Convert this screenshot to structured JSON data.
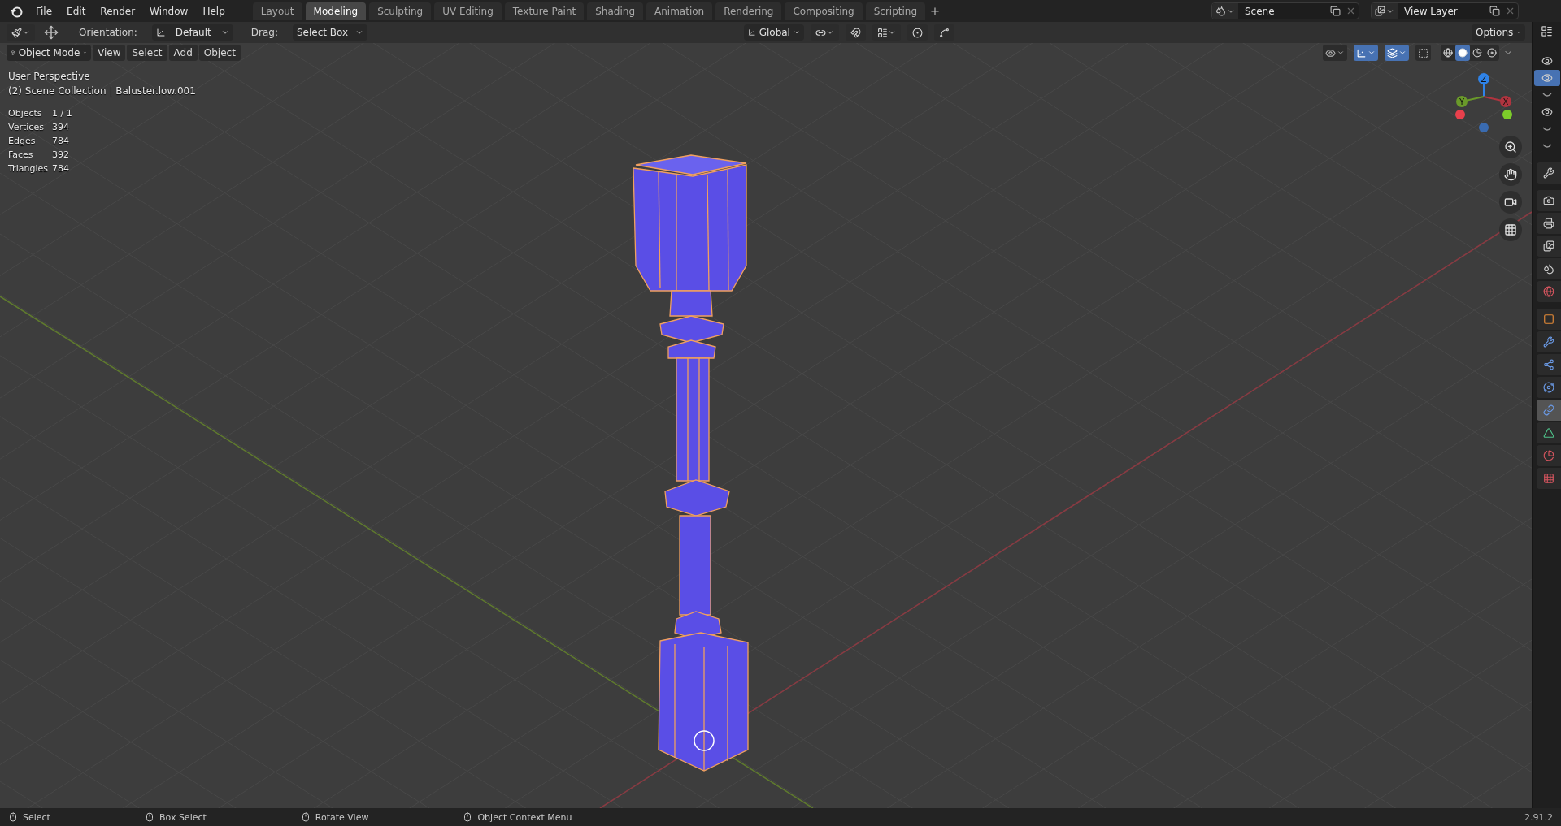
{
  "app_menu": [
    "File",
    "Edit",
    "Render",
    "Window",
    "Help"
  ],
  "workspace_tabs": [
    {
      "label": "Layout",
      "selected": false
    },
    {
      "label": "Modeling",
      "selected": true
    },
    {
      "label": "Sculpting",
      "selected": false
    },
    {
      "label": "UV Editing",
      "selected": false
    },
    {
      "label": "Texture Paint",
      "selected": false
    },
    {
      "label": "Shading",
      "selected": false
    },
    {
      "label": "Animation",
      "selected": false
    },
    {
      "label": "Rendering",
      "selected": false
    },
    {
      "label": "Compositing",
      "selected": false
    },
    {
      "label": "Scripting",
      "selected": false
    }
  ],
  "scene": {
    "value": "Scene"
  },
  "view_layer": {
    "value": "View Layer"
  },
  "tool_header": {
    "orientation_label": "Orientation:",
    "orientation": "Default",
    "drag_label": "Drag:",
    "drag": "Select Box",
    "transform_orientation": "Global",
    "options": "Options"
  },
  "viewport_header": {
    "mode": "Object Mode",
    "menus": [
      "View",
      "Select",
      "Add",
      "Object"
    ],
    "toggles": [
      {
        "kind": "selectability",
        "on": false
      },
      {
        "kind": "gizmos",
        "on": true
      },
      {
        "kind": "overlays",
        "on": true
      },
      {
        "kind": "xray",
        "on": false
      }
    ],
    "shading_modes": [
      {
        "kind": "wireframe",
        "selected": false
      },
      {
        "kind": "solid",
        "selected": true
      },
      {
        "kind": "material",
        "selected": false
      },
      {
        "kind": "rendered",
        "selected": false
      }
    ]
  },
  "overlay_info": {
    "view": "User Perspective",
    "collection": "(2) Scene Collection | Baluster.low.001",
    "stats": [
      {
        "label": "Objects",
        "value": "1 / 1"
      },
      {
        "label": "Vertices",
        "value": "394"
      },
      {
        "label": "Edges",
        "value": "784"
      },
      {
        "label": "Faces",
        "value": "392"
      },
      {
        "label": "Triangles",
        "value": "784"
      }
    ]
  },
  "gizmo_axes": [
    {
      "label": "Z",
      "color": "#2f83e8"
    },
    {
      "label": "Y",
      "color": "#6a9a2a"
    },
    {
      "label": "X",
      "color": "#b0343f"
    }
  ],
  "outliner_rows": [
    {
      "visible": true,
      "selected": false
    },
    {
      "visible": true,
      "selected": true
    },
    {
      "visible": false,
      "selected": false
    },
    {
      "visible": true,
      "selected": false
    },
    {
      "visible": false,
      "selected": false
    },
    {
      "visible": false,
      "selected": false
    }
  ],
  "properties_tabs": [
    {
      "kind": "tool",
      "selected": false
    },
    {
      "kind": "render",
      "selected": false
    },
    {
      "kind": "output",
      "selected": false
    },
    {
      "kind": "view_layer",
      "selected": false
    },
    {
      "kind": "scene",
      "selected": false
    },
    {
      "kind": "world",
      "selected": false
    },
    {
      "kind": "object",
      "selected": false
    },
    {
      "kind": "modifiers",
      "selected": false
    },
    {
      "kind": "particles",
      "selected": false
    },
    {
      "kind": "physics",
      "selected": false
    },
    {
      "kind": "constraints",
      "selected": true
    },
    {
      "kind": "data",
      "selected": false
    },
    {
      "kind": "material",
      "selected": false
    },
    {
      "kind": "texture",
      "selected": false
    }
  ],
  "status_bar": {
    "hints": [
      "Select",
      "Box Select",
      "Rotate View",
      "Object Context Menu"
    ],
    "version": "2.91.2"
  }
}
